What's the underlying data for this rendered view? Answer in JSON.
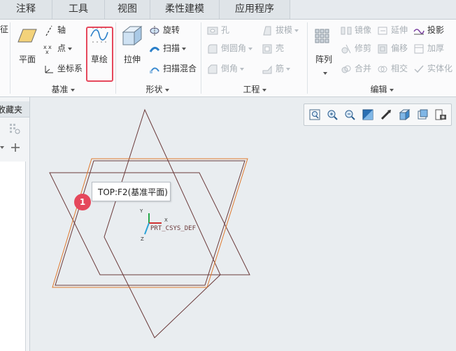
{
  "tabs": [
    "注释",
    "工具",
    "视图",
    "柔性建模",
    "应用程序"
  ],
  "ribbon": {
    "cut_label": "征",
    "datum": {
      "plane_label": "平面",
      "axis_label": "轴",
      "point_label": "点",
      "csys_label": "坐标系",
      "sketch_label": "草绘",
      "group_label": "基准"
    },
    "shapes": {
      "extrude_label": "拉伸",
      "revolve_label": "旋转",
      "sweep_label": "扫描",
      "swept_blend_label": "扫描混合",
      "group_label": "形状"
    },
    "engineering": {
      "hole_label": "孔",
      "round_label": "倒圆角",
      "chamfer_label": "倒角",
      "draft_label": "拔模",
      "shell_label": "壳",
      "rib_label": "筋",
      "group_label": "工程"
    },
    "editing": {
      "pattern_label": "阵列",
      "mirror_label": "镜像",
      "trim_label": "修剪",
      "merge_label": "合并",
      "extend_label": "延伸",
      "offset_label": "偏移",
      "intersect_label": "相交",
      "project_label": "投影",
      "thicken_label": "加厚",
      "solidify_label": "实体化",
      "group_label": "编辑"
    }
  },
  "left_panel": {
    "header_label": "收藏夹"
  },
  "canvas": {
    "csys_label": "PRT_CSYS_DEF",
    "axis_x": "X",
    "axis_y": "Y",
    "axis_z": "Z"
  },
  "tooltip": {
    "text": "TOP:F2(基准平面)"
  },
  "callout": {
    "number": "1"
  },
  "colors": {
    "highlight_red": "#e6485c",
    "plane_line": "#6b3a3a",
    "plane_selected": "#e07a2e"
  }
}
